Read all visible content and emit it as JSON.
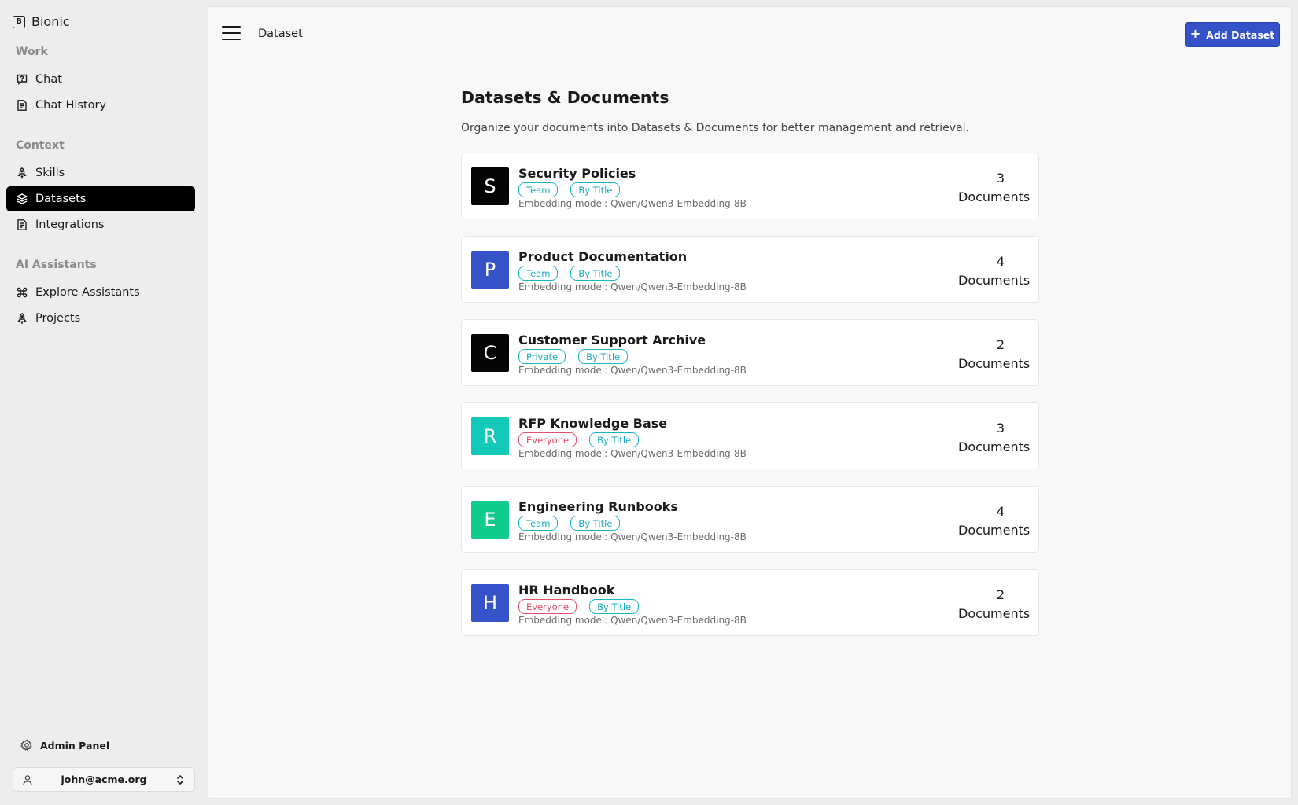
{
  "brand": {
    "logo_letter": "B",
    "name": "Bionic"
  },
  "sidebar": {
    "sections": [
      {
        "title": "Work",
        "items": [
          {
            "label": "Chat",
            "icon": "chat-question-icon"
          },
          {
            "label": "Chat History",
            "icon": "history-doc-icon"
          }
        ]
      },
      {
        "title": "Context",
        "items": [
          {
            "label": "Skills",
            "icon": "rocket-icon"
          },
          {
            "label": "Datasets",
            "icon": "layers-icon",
            "active": true
          },
          {
            "label": "Integrations",
            "icon": "integration-doc-icon"
          }
        ]
      },
      {
        "title": "AI Assistants",
        "items": [
          {
            "label": "Explore Assistants",
            "icon": "command-icon"
          },
          {
            "label": "Projects",
            "icon": "rocket-icon"
          }
        ]
      }
    ],
    "admin_label": "Admin Panel",
    "user_email": "john@acme.org"
  },
  "topbar": {
    "title": "Dataset",
    "add_button": "Add Dataset"
  },
  "page": {
    "title": "Datasets & Documents",
    "description": "Organize your documents into Datasets & Documents for better management and retrieval."
  },
  "colors": {
    "accent": "#3552c9",
    "active_nav": "#000000",
    "tag_cyan": "#18b5c9",
    "tag_red": "#e0526a"
  },
  "datasets": [
    {
      "letter": "S",
      "avatar_color": "#050505",
      "name": "Security Policies",
      "visibility": "Team",
      "visibility_style": "cyan",
      "chunking": "By Title",
      "embedding": "Embedding model: Qwen/Qwen3-Embedding-8B",
      "count": "3",
      "count_label": "Documents"
    },
    {
      "letter": "P",
      "avatar_color": "#3552c9",
      "name": "Product Documentation",
      "visibility": "Team",
      "visibility_style": "cyan",
      "chunking": "By Title",
      "embedding": "Embedding model: Qwen/Qwen3-Embedding-8B",
      "count": "4",
      "count_label": "Documents"
    },
    {
      "letter": "C",
      "avatar_color": "#050505",
      "name": "Customer Support Archive",
      "visibility": "Private",
      "visibility_style": "cyan",
      "chunking": "By Title",
      "embedding": "Embedding model: Qwen/Qwen3-Embedding-8B",
      "count": "2",
      "count_label": "Documents"
    },
    {
      "letter": "R",
      "avatar_color": "#13c9b8",
      "name": "RFP Knowledge Base",
      "visibility": "Everyone",
      "visibility_style": "red",
      "chunking": "By Title",
      "embedding": "Embedding model: Qwen/Qwen3-Embedding-8B",
      "count": "3",
      "count_label": "Documents"
    },
    {
      "letter": "E",
      "avatar_color": "#0fcc8c",
      "name": "Engineering Runbooks",
      "visibility": "Team",
      "visibility_style": "cyan",
      "chunking": "By Title",
      "embedding": "Embedding model: Qwen/Qwen3-Embedding-8B",
      "count": "4",
      "count_label": "Documents"
    },
    {
      "letter": "H",
      "avatar_color": "#3552c9",
      "name": "HR Handbook",
      "visibility": "Everyone",
      "visibility_style": "red",
      "chunking": "By Title",
      "embedding": "Embedding model: Qwen/Qwen3-Embedding-8B",
      "count": "2",
      "count_label": "Documents"
    }
  ]
}
